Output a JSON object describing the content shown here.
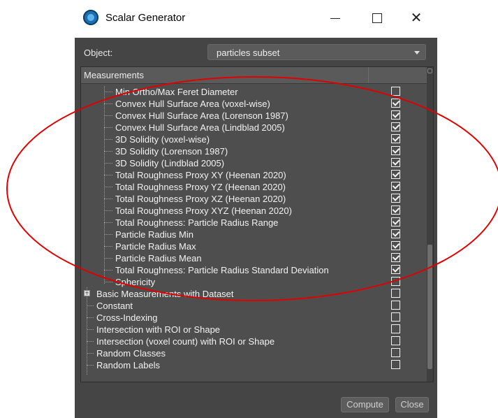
{
  "window": {
    "title": "Scalar Generator",
    "controls": {
      "minimize": "—",
      "maximize": "☐",
      "close": "✕"
    }
  },
  "object": {
    "label": "Object:",
    "value": "particles subset"
  },
  "tree": {
    "header": "Measurements",
    "items": [
      {
        "label": "Min Ortho/Max Feret Diameter",
        "level": 2,
        "checked": false
      },
      {
        "label": "Convex Hull Surface Area (voxel-wise)",
        "level": 2,
        "checked": true
      },
      {
        "label": "Convex Hull Surface Area (Lorenson 1987)",
        "level": 2,
        "checked": true
      },
      {
        "label": "Convex Hull Surface Area (Lindblad 2005)",
        "level": 2,
        "checked": true
      },
      {
        "label": "3D Solidity (voxel-wise)",
        "level": 2,
        "checked": true
      },
      {
        "label": "3D Solidity (Lorenson 1987)",
        "level": 2,
        "checked": true
      },
      {
        "label": "3D Solidity (Lindblad 2005)",
        "level": 2,
        "checked": true
      },
      {
        "label": "Total Roughness Proxy XY (Heenan 2020)",
        "level": 2,
        "checked": true
      },
      {
        "label": "Total Roughness Proxy YZ (Heenan 2020)",
        "level": 2,
        "checked": true
      },
      {
        "label": "Total Roughness Proxy XZ (Heenan 2020)",
        "level": 2,
        "checked": true
      },
      {
        "label": "Total Roughness Proxy XYZ (Heenan 2020)",
        "level": 2,
        "checked": true
      },
      {
        "label": "Total Roughness: Particle Radius Range",
        "level": 2,
        "checked": true
      },
      {
        "label": "Particle Radius Min",
        "level": 2,
        "checked": true
      },
      {
        "label": "Particle Radius Max",
        "level": 2,
        "checked": true
      },
      {
        "label": "Particle Radius Mean",
        "level": 2,
        "checked": true
      },
      {
        "label": "Total Roughness: Particle Radius Standard Deviation",
        "level": 2,
        "checked": true
      },
      {
        "label": "Sphericity",
        "level": 2,
        "checked": false
      },
      {
        "label": "Basic Measurements with Dataset",
        "level": 1,
        "checked": false,
        "expander": "+"
      },
      {
        "label": "Constant",
        "level": 1,
        "checked": false
      },
      {
        "label": "Cross-Indexing",
        "level": 1,
        "checked": false
      },
      {
        "label": "Intersection with ROI or Shape",
        "level": 1,
        "checked": false
      },
      {
        "label": "Intersection (voxel count) with ROI or Shape",
        "level": 1,
        "checked": false
      },
      {
        "label": "Random Classes",
        "level": 1,
        "checked": false
      },
      {
        "label": "Random Labels",
        "level": 1,
        "checked": false
      }
    ]
  },
  "buttons": {
    "compute": "Compute",
    "close": "Close"
  },
  "annotation_color": "#e00000"
}
